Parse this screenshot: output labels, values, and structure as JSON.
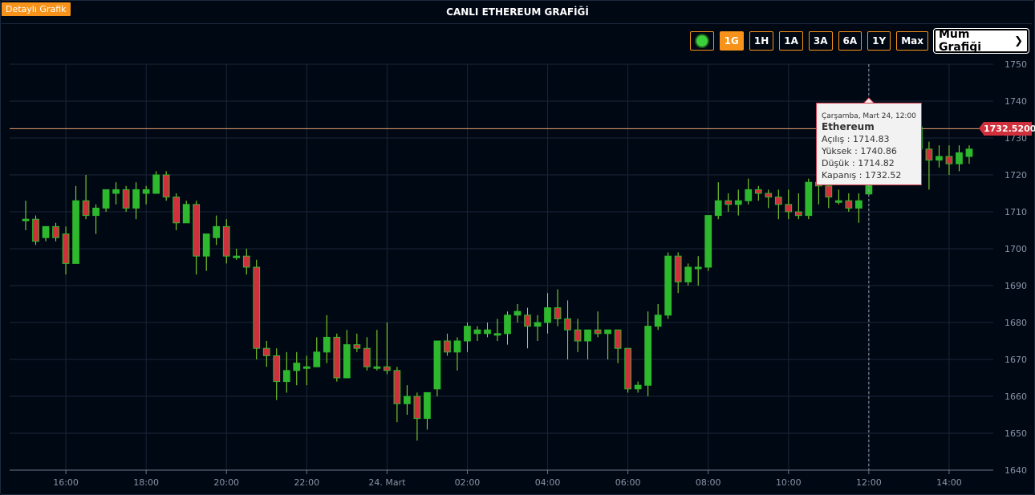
{
  "header": {
    "detail_button": "Detaylı Grafik",
    "title": "CANLI ETHEREUM GRAFİĞİ"
  },
  "toolbar": {
    "ranges": [
      "1G",
      "1H",
      "1A",
      "3A",
      "6A",
      "1Y",
      "Max"
    ],
    "active_range": "1G",
    "chart_type": "Mum Grafiği"
  },
  "tooltip": {
    "date": "Çarşamba, Mart 24, 12:00",
    "series": "Ethereum",
    "open": "Açılış : 1714.83",
    "high": "Yüksek : 1740.86",
    "low": "Düşük : 1714.82",
    "close": "Kapanış : 1732.52"
  },
  "current_price_label": "1732.5200",
  "colors": {
    "up": "#2db82d",
    "down": "#d0303c",
    "wick": "#8ee82d",
    "accent": "#f7931a",
    "grid": "#1a2636",
    "background": "#000814"
  },
  "chart_data": {
    "type": "candlestick",
    "current_price": 1732.52,
    "y_ticks": [
      "1640",
      "1650",
      "1660",
      "1670",
      "1680",
      "1690",
      "1700",
      "1710",
      "1720",
      "1730",
      "1740",
      "1750"
    ],
    "ylim": [
      1640,
      1750
    ],
    "x_ticks": [
      "16:00",
      "18:00",
      "20:00",
      "22:00",
      "24. Mart",
      "02:00",
      "04:00",
      "06:00",
      "08:00",
      "10:00",
      "12:00",
      "14:00"
    ],
    "x_tick_hours": [
      0,
      2,
      4,
      6,
      8,
      10,
      12,
      14,
      16,
      18,
      20,
      22
    ],
    "crosshair_hour": 20,
    "xlim_hours": [
      -1.4,
      23.1
    ],
    "candles": [
      {
        "t": -1.0,
        "o": 1708,
        "h": 1713,
        "l": 1705,
        "c": 1708
      },
      {
        "t": -0.75,
        "o": 1708,
        "h": 1709,
        "l": 1701,
        "c": 1702
      },
      {
        "t": -0.5,
        "o": 1703,
        "h": 1706,
        "l": 1702,
        "c": 1706
      },
      {
        "t": -0.25,
        "o": 1706,
        "h": 1707,
        "l": 1702,
        "c": 1703
      },
      {
        "t": 0.0,
        "o": 1704,
        "h": 1706,
        "l": 1693,
        "c": 1696
      },
      {
        "t": 0.25,
        "o": 1696,
        "h": 1717,
        "l": 1696,
        "c": 1713
      },
      {
        "t": 0.5,
        "o": 1713,
        "h": 1720,
        "l": 1708,
        "c": 1709
      },
      {
        "t": 0.75,
        "o": 1709,
        "h": 1712,
        "l": 1704,
        "c": 1711
      },
      {
        "t": 1.0,
        "o": 1711,
        "h": 1716,
        "l": 1710,
        "c": 1716
      },
      {
        "t": 1.25,
        "o": 1715,
        "h": 1718,
        "l": 1712,
        "c": 1716
      },
      {
        "t": 1.5,
        "o": 1716,
        "h": 1717,
        "l": 1710,
        "c": 1711
      },
      {
        "t": 1.75,
        "o": 1711,
        "h": 1718,
        "l": 1708,
        "c": 1716
      },
      {
        "t": 2.0,
        "o": 1715,
        "h": 1717,
        "l": 1712,
        "c": 1716
      },
      {
        "t": 2.25,
        "o": 1715,
        "h": 1721,
        "l": 1715,
        "c": 1720
      },
      {
        "t": 2.5,
        "o": 1720,
        "h": 1721,
        "l": 1713,
        "c": 1714
      },
      {
        "t": 2.75,
        "o": 1714,
        "h": 1715,
        "l": 1705,
        "c": 1707
      },
      {
        "t": 3.0,
        "o": 1707,
        "h": 1713,
        "l": 1707,
        "c": 1712
      },
      {
        "t": 3.25,
        "o": 1712,
        "h": 1713,
        "l": 1693,
        "c": 1698
      },
      {
        "t": 3.5,
        "o": 1698,
        "h": 1704,
        "l": 1694,
        "c": 1704
      },
      {
        "t": 3.75,
        "o": 1703,
        "h": 1709,
        "l": 1701,
        "c": 1706
      },
      {
        "t": 4.0,
        "o": 1706,
        "h": 1708,
        "l": 1696,
        "c": 1698
      },
      {
        "t": 4.25,
        "o": 1698,
        "h": 1700,
        "l": 1697,
        "c": 1698
      },
      {
        "t": 4.5,
        "o": 1698,
        "h": 1700,
        "l": 1693,
        "c": 1695
      },
      {
        "t": 4.75,
        "o": 1695,
        "h": 1697,
        "l": 1670,
        "c": 1673
      },
      {
        "t": 5.0,
        "o": 1673,
        "h": 1675,
        "l": 1668,
        "c": 1671
      },
      {
        "t": 5.25,
        "o": 1671,
        "h": 1673,
        "l": 1659,
        "c": 1664
      },
      {
        "t": 5.5,
        "o": 1664,
        "h": 1672,
        "l": 1661,
        "c": 1667
      },
      {
        "t": 5.75,
        "o": 1667,
        "h": 1672,
        "l": 1663,
        "c": 1669
      },
      {
        "t": 6.0,
        "o": 1668,
        "h": 1671,
        "l": 1663,
        "c": 1668
      },
      {
        "t": 6.25,
        "o": 1668,
        "h": 1676,
        "l": 1668,
        "c": 1672
      },
      {
        "t": 6.5,
        "o": 1672,
        "h": 1682,
        "l": 1669,
        "c": 1676
      },
      {
        "t": 6.75,
        "o": 1676,
        "h": 1677,
        "l": 1664,
        "c": 1665
      },
      {
        "t": 7.0,
        "o": 1665,
        "h": 1678,
        "l": 1665,
        "c": 1674
      },
      {
        "t": 7.25,
        "o": 1674,
        "h": 1677,
        "l": 1672,
        "c": 1673
      },
      {
        "t": 7.5,
        "o": 1673,
        "h": 1676,
        "l": 1667,
        "c": 1668
      },
      {
        "t": 7.75,
        "o": 1668,
        "h": 1678,
        "l": 1667,
        "c": 1668
      },
      {
        "t": 8.0,
        "o": 1668,
        "h": 1680,
        "l": 1666,
        "c": 1667
      },
      {
        "t": 8.25,
        "o": 1667,
        "h": 1668,
        "l": 1653,
        "c": 1658
      },
      {
        "t": 8.5,
        "o": 1658,
        "h": 1663,
        "l": 1655,
        "c": 1660
      },
      {
        "t": 8.75,
        "o": 1660,
        "h": 1661,
        "l": 1648,
        "c": 1654
      },
      {
        "t": 9.0,
        "o": 1654,
        "h": 1661,
        "l": 1651,
        "c": 1661
      },
      {
        "t": 9.25,
        "o": 1662,
        "h": 1675,
        "l": 1660,
        "c": 1675
      },
      {
        "t": 9.5,
        "o": 1675,
        "h": 1677,
        "l": 1671,
        "c": 1672
      },
      {
        "t": 9.75,
        "o": 1672,
        "h": 1676,
        "l": 1667,
        "c": 1675
      },
      {
        "t": 10.0,
        "o": 1675,
        "h": 1680,
        "l": 1672,
        "c": 1679
      },
      {
        "t": 10.25,
        "o": 1677,
        "h": 1679,
        "l": 1675,
        "c": 1678
      },
      {
        "t": 10.5,
        "o": 1677,
        "h": 1680,
        "l": 1676,
        "c": 1678
      },
      {
        "t": 10.75,
        "o": 1677,
        "h": 1681,
        "l": 1675,
        "c": 1677
      },
      {
        "t": 11.0,
        "o": 1677,
        "h": 1683,
        "l": 1674,
        "c": 1682
      },
      {
        "t": 11.25,
        "o": 1682,
        "h": 1685,
        "l": 1680,
        "c": 1683
      },
      {
        "t": 11.5,
        "o": 1682,
        "h": 1684,
        "l": 1673,
        "c": 1679
      },
      {
        "t": 11.75,
        "o": 1679,
        "h": 1682,
        "l": 1675,
        "c": 1680
      },
      {
        "t": 12.0,
        "o": 1680,
        "h": 1688,
        "l": 1677,
        "c": 1684
      },
      {
        "t": 12.25,
        "o": 1684,
        "h": 1689,
        "l": 1679,
        "c": 1681
      },
      {
        "t": 12.5,
        "o": 1681,
        "h": 1686,
        "l": 1670,
        "c": 1678
      },
      {
        "t": 12.75,
        "o": 1678,
        "h": 1681,
        "l": 1672,
        "c": 1675
      },
      {
        "t": 13.0,
        "o": 1675,
        "h": 1678,
        "l": 1670,
        "c": 1678
      },
      {
        "t": 13.25,
        "o": 1678,
        "h": 1683,
        "l": 1676,
        "c": 1677
      },
      {
        "t": 13.5,
        "o": 1677,
        "h": 1678,
        "l": 1670,
        "c": 1678
      },
      {
        "t": 13.75,
        "o": 1678,
        "h": 1678,
        "l": 1669,
        "c": 1673
      },
      {
        "t": 14.0,
        "o": 1673,
        "h": 1673,
        "l": 1661,
        "c": 1662
      },
      {
        "t": 14.25,
        "o": 1662,
        "h": 1664,
        "l": 1661,
        "c": 1663
      },
      {
        "t": 14.5,
        "o": 1663,
        "h": 1683,
        "l": 1660,
        "c": 1679
      },
      {
        "t": 14.75,
        "o": 1679,
        "h": 1685,
        "l": 1678,
        "c": 1682
      },
      {
        "t": 15.0,
        "o": 1682,
        "h": 1699,
        "l": 1681,
        "c": 1698
      },
      {
        "t": 15.25,
        "o": 1698,
        "h": 1699,
        "l": 1688,
        "c": 1691
      },
      {
        "t": 15.5,
        "o": 1691,
        "h": 1696,
        "l": 1690,
        "c": 1695
      },
      {
        "t": 15.75,
        "o": 1695,
        "h": 1698,
        "l": 1690,
        "c": 1695
      },
      {
        "t": 16.0,
        "o": 1695,
        "h": 1709,
        "l": 1694,
        "c": 1709
      },
      {
        "t": 16.25,
        "o": 1709,
        "h": 1718,
        "l": 1708,
        "c": 1713
      },
      {
        "t": 16.5,
        "o": 1713,
        "h": 1715,
        "l": 1710,
        "c": 1712
      },
      {
        "t": 16.75,
        "o": 1712,
        "h": 1716,
        "l": 1709,
        "c": 1713
      },
      {
        "t": 17.0,
        "o": 1713,
        "h": 1719,
        "l": 1712,
        "c": 1716
      },
      {
        "t": 17.25,
        "o": 1716,
        "h": 1717,
        "l": 1713,
        "c": 1715
      },
      {
        "t": 17.5,
        "o": 1715,
        "h": 1716,
        "l": 1711,
        "c": 1714
      },
      {
        "t": 17.75,
        "o": 1714,
        "h": 1716,
        "l": 1708,
        "c": 1712
      },
      {
        "t": 18.0,
        "o": 1712,
        "h": 1716,
        "l": 1708,
        "c": 1710
      },
      {
        "t": 18.25,
        "o": 1710,
        "h": 1715,
        "l": 1708,
        "c": 1709
      },
      {
        "t": 18.5,
        "o": 1709,
        "h": 1719,
        "l": 1708,
        "c": 1718
      },
      {
        "t": 18.75,
        "o": 1718,
        "h": 1720,
        "l": 1712,
        "c": 1717
      },
      {
        "t": 19.0,
        "o": 1717,
        "h": 1720,
        "l": 1711,
        "c": 1714
      },
      {
        "t": 19.25,
        "o": 1713,
        "h": 1716,
        "l": 1712,
        "c": 1713
      },
      {
        "t": 19.5,
        "o": 1713,
        "h": 1715,
        "l": 1710,
        "c": 1711
      },
      {
        "t": 19.75,
        "o": 1711,
        "h": 1715,
        "l": 1707,
        "c": 1713
      },
      {
        "t": 20.0,
        "o": 1714.83,
        "h": 1740.86,
        "l": 1714.82,
        "c": 1732.52
      },
      {
        "t": 20.25,
        "o": 1731,
        "h": 1734,
        "l": 1726,
        "c": 1733
      },
      {
        "t": 20.5,
        "o": 1733,
        "h": 1736,
        "l": 1729,
        "c": 1734
      },
      {
        "t": 20.75,
        "o": 1734,
        "h": 1737,
        "l": 1730,
        "c": 1733
      },
      {
        "t": 21.0,
        "o": 1733,
        "h": 1735,
        "l": 1729,
        "c": 1734
      },
      {
        "t": 21.25,
        "o": 1733,
        "h": 1736,
        "l": 1726,
        "c": 1727
      },
      {
        "t": 21.5,
        "o": 1727,
        "h": 1729,
        "l": 1716,
        "c": 1724
      },
      {
        "t": 21.75,
        "o": 1724,
        "h": 1728,
        "l": 1722,
        "c": 1725
      },
      {
        "t": 22.0,
        "o": 1725,
        "h": 1728,
        "l": 1720,
        "c": 1723
      },
      {
        "t": 22.25,
        "o": 1723,
        "h": 1728,
        "l": 1721,
        "c": 1726
      },
      {
        "t": 22.5,
        "o": 1725,
        "h": 1728,
        "l": 1723,
        "c": 1727
      }
    ]
  }
}
